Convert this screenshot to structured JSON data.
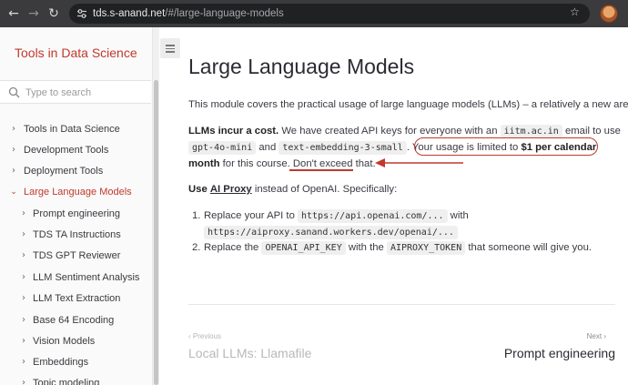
{
  "browser": {
    "url_host": "tds.s-anand.net",
    "url_rest": "/#/large-language-models"
  },
  "sidebar": {
    "title": "Tools in Data Science",
    "search_placeholder": "Type to search",
    "items": [
      {
        "label": "Tools in Data Science"
      },
      {
        "label": "Development Tools"
      },
      {
        "label": "Deployment Tools"
      },
      {
        "label": "Large Language Models"
      },
      {
        "label": "Prompt engineering"
      },
      {
        "label": "TDS TA Instructions"
      },
      {
        "label": "TDS GPT Reviewer"
      },
      {
        "label": "LLM Sentiment Analysis"
      },
      {
        "label": "LLM Text Extraction"
      },
      {
        "label": "Base 64 Encoding"
      },
      {
        "label": "Vision Models"
      },
      {
        "label": "Embeddings"
      },
      {
        "label": "Topic modeling"
      }
    ]
  },
  "main": {
    "title": "Large Language Models",
    "intro": "This module covers the practical usage of large language models (LLMs) – a relatively a new area.",
    "p2": {
      "bold": "LLMs incur a cost.",
      "t1": " We have created API keys for everyone with an ",
      "code1": "iitm.ac.in",
      "t2": " email to use",
      "code2": "gpt-4o-mini",
      "t3": " and ",
      "code3": "text-embedding-3-small",
      "t4": ". ",
      "t5": "Your usage is limited to ",
      "bold2": "$1 per calendar",
      "bold3": "month",
      "t6": " for this course. ",
      "t7": "Don't exceed that."
    },
    "p3": {
      "bold": "Use",
      "link": "AI Proxy",
      "rest": " instead of OpenAI. Specifically:"
    },
    "steps": [
      {
        "num": "1.",
        "t1": "Replace your API to ",
        "code1": "https://api.openai.com/...",
        "t2": " with",
        "code2": "https://aiproxy.sanand.workers.dev/openai/..."
      },
      {
        "num": "2.",
        "t1": "Replace the ",
        "code1": "OPENAI_API_KEY",
        "t2": " with the ",
        "code2": "AIPROXY_TOKEN",
        "t3": " that someone will give you."
      }
    ],
    "pager": {
      "prev_label": "Previous",
      "prev_title": "Local LLMs: Llamafile",
      "next_label": "Next",
      "next_title": "Prompt engineering"
    }
  },
  "colors": {
    "accent": "#c0392b",
    "chrome": "#3b3b3e"
  },
  "icons": [
    "back-icon",
    "forward-icon",
    "reload-icon",
    "site-settings-icon",
    "bookmark-star-icon",
    "search-icon",
    "menu-icon",
    "chevron-right-icon",
    "chevron-down-icon"
  ]
}
